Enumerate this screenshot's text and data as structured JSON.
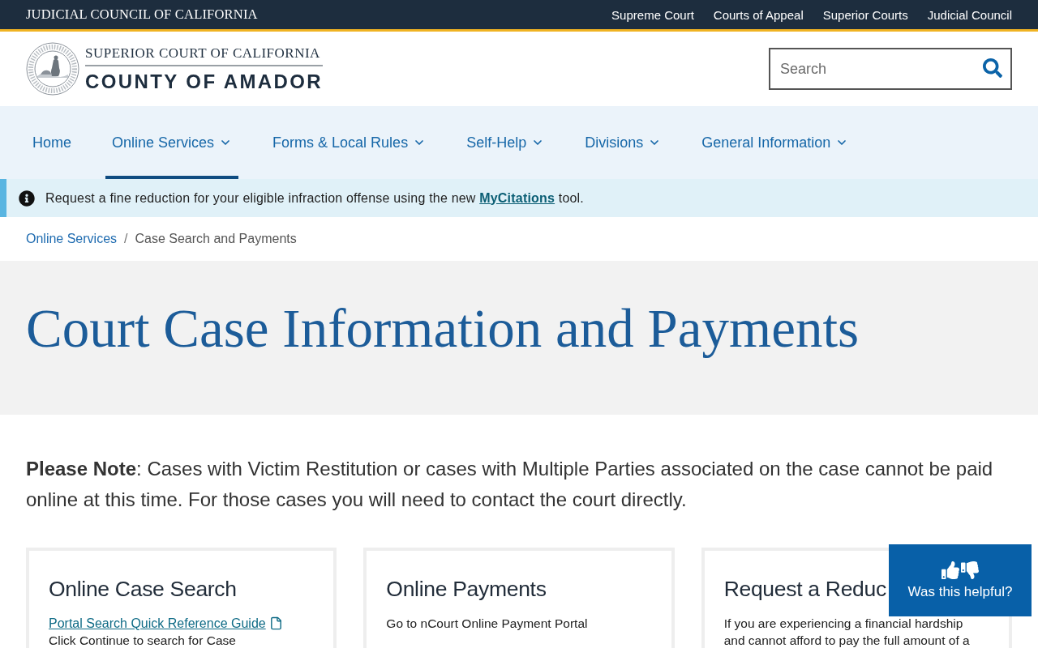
{
  "top_bar": {
    "title": "JUDICIAL COUNCIL OF CALIFORNIA",
    "links": [
      "Supreme Court",
      "Courts of Appeal",
      "Superior Courts",
      "Judicial Council"
    ]
  },
  "header": {
    "logo": {
      "line_1": "SUPERIOR COURT OF CALIFORNIA",
      "line_2": "COUNTY OF AMADOR"
    },
    "search": {
      "placeholder": "Search"
    }
  },
  "nav": {
    "items": [
      {
        "label": "Home",
        "has_menu": false,
        "selected": false
      },
      {
        "label": "Online Services",
        "has_menu": true,
        "selected": true
      },
      {
        "label": "Forms & Local Rules",
        "has_menu": true,
        "selected": false
      },
      {
        "label": "Self-Help",
        "has_menu": true,
        "selected": false
      },
      {
        "label": "Divisions",
        "has_menu": true,
        "selected": false
      },
      {
        "label": "General Information",
        "has_menu": true,
        "selected": false
      }
    ]
  },
  "alert": {
    "text": "Request a fine reduction for your eligible infraction offense using the new",
    "link": "MyCitations",
    "text_after": "tool."
  },
  "breadcrumb": {
    "separator": "/",
    "items": [
      {
        "label": "Online Services",
        "kind": "link"
      },
      {
        "label": "Case Search and Payments",
        "kind": "current"
      }
    ]
  },
  "hero": {
    "title": "Court Case Information and Payments"
  },
  "note": "**Please Note**: Cases with Victim Restitution or cases with Multiple Parties associated on the case cannot be paid online at this time. For those cases you will need to contact the court directly.",
  "cards": [
    {
      "title": "Online Case Search",
      "lines": [
        {
          "kind": "document_link",
          "text": "Portal Search Quick Reference Guide"
        },
        {
          "kind": "text",
          "text": "Click Continue to search for Case"
        }
      ]
    },
    {
      "title": "Online Payments",
      "lines": [
        {
          "kind": "text",
          "text": "Go to nCourt Online Payment Portal"
        }
      ]
    },
    {
      "title": "Request a Reduc",
      "lines": [
        {
          "kind": "text",
          "text": "If you are experiencing a financial hardship and cannot afford to pay the full amount of a"
        }
      ]
    }
  ],
  "feedback": {
    "label": "Was this helpful?"
  }
}
